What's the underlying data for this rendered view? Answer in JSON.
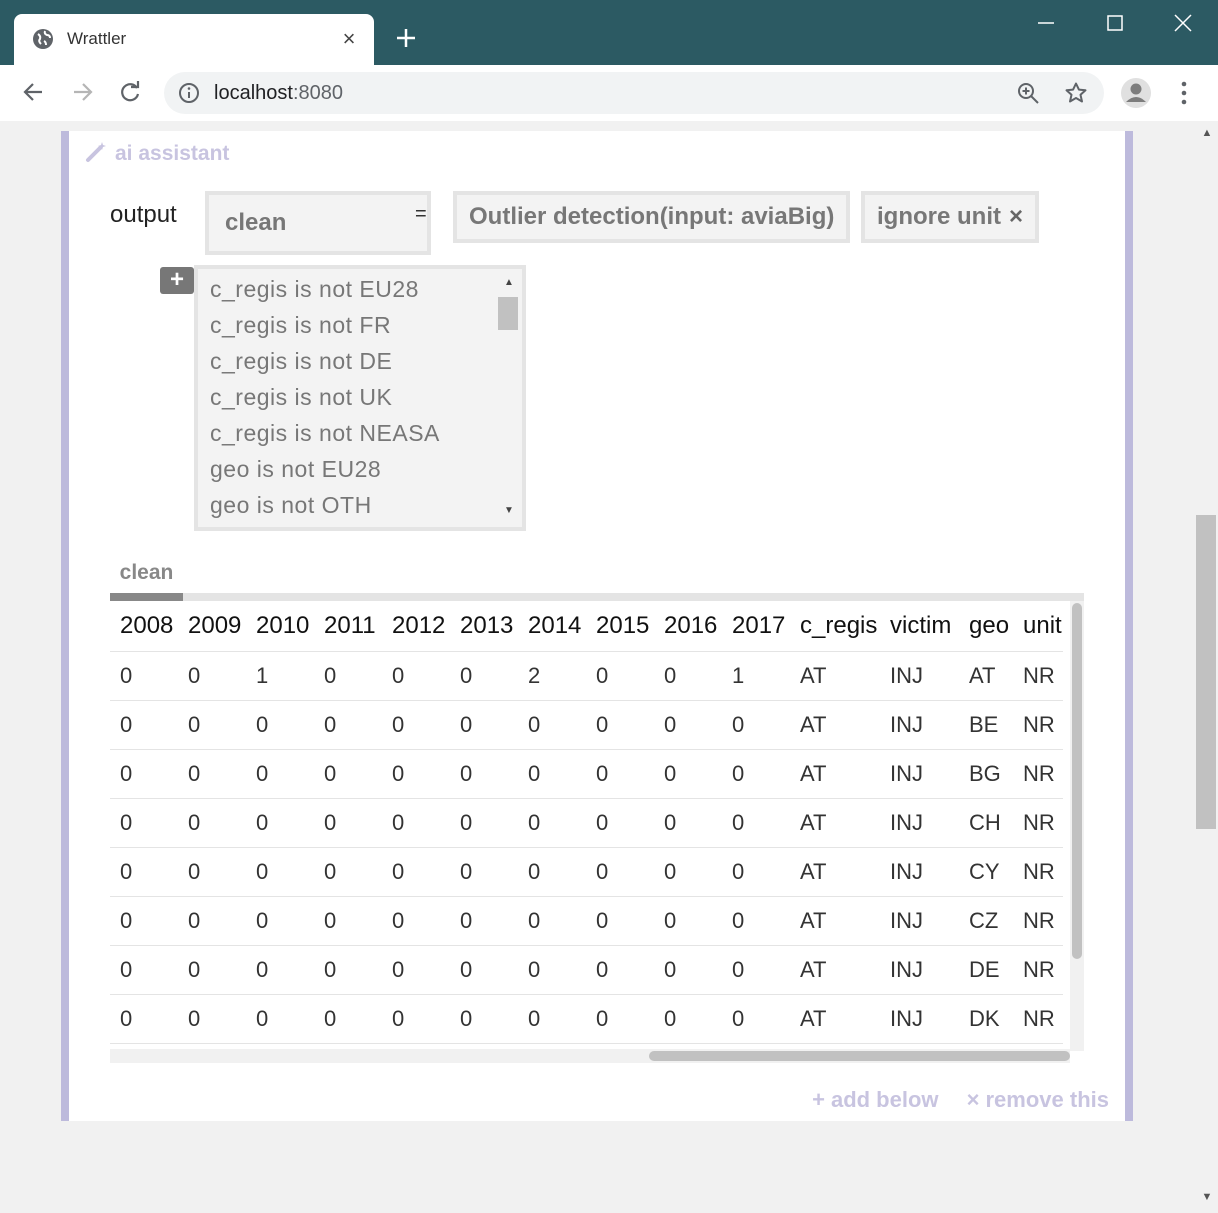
{
  "browser": {
    "tab_title": "Wrattler",
    "tab_close": "×",
    "new_tab": "+",
    "url_host": "localhost",
    "url_port": ":8080"
  },
  "cell": {
    "ai_label": "ai assistant",
    "output_label": "output",
    "output_value": "clean",
    "equals": "=",
    "operation": "Outlier detection(input: aviaBig)",
    "ignore_chip": {
      "label": "ignore unit",
      "remove": "×"
    },
    "add_filter": "+",
    "filters": [
      "c_regis is not EU28",
      "c_regis is not FR",
      "c_regis is not DE",
      "c_regis is not UK",
      "c_regis is not NEASA",
      "geo is not EU28",
      "geo is not OTH"
    ],
    "data_tab": "clean",
    "table": {
      "columns": [
        "2008",
        "2009",
        "2010",
        "2011",
        "2012",
        "2013",
        "2014",
        "2015",
        "2016",
        "2017",
        "c_regis",
        "victim",
        "geo",
        "unit"
      ],
      "rows": [
        [
          "0",
          "0",
          "1",
          "0",
          "0",
          "0",
          "2",
          "0",
          "0",
          "1",
          "AT",
          "INJ",
          "AT",
          "NR"
        ],
        [
          "0",
          "0",
          "0",
          "0",
          "0",
          "0",
          "0",
          "0",
          "0",
          "0",
          "AT",
          "INJ",
          "BE",
          "NR"
        ],
        [
          "0",
          "0",
          "0",
          "0",
          "0",
          "0",
          "0",
          "0",
          "0",
          "0",
          "AT",
          "INJ",
          "BG",
          "NR"
        ],
        [
          "0",
          "0",
          "0",
          "0",
          "0",
          "0",
          "0",
          "0",
          "0",
          "0",
          "AT",
          "INJ",
          "CH",
          "NR"
        ],
        [
          "0",
          "0",
          "0",
          "0",
          "0",
          "0",
          "0",
          "0",
          "0",
          "0",
          "AT",
          "INJ",
          "CY",
          "NR"
        ],
        [
          "0",
          "0",
          "0",
          "0",
          "0",
          "0",
          "0",
          "0",
          "0",
          "0",
          "AT",
          "INJ",
          "CZ",
          "NR"
        ],
        [
          "0",
          "0",
          "0",
          "0",
          "0",
          "0",
          "0",
          "0",
          "0",
          "0",
          "AT",
          "INJ",
          "DE",
          "NR"
        ],
        [
          "0",
          "0",
          "0",
          "0",
          "0",
          "0",
          "0",
          "0",
          "0",
          "0",
          "AT",
          "INJ",
          "DK",
          "NR"
        ]
      ]
    },
    "actions": {
      "add_below": "add below",
      "remove_this": "remove this",
      "add_icon": "+",
      "remove_icon": "×"
    }
  }
}
